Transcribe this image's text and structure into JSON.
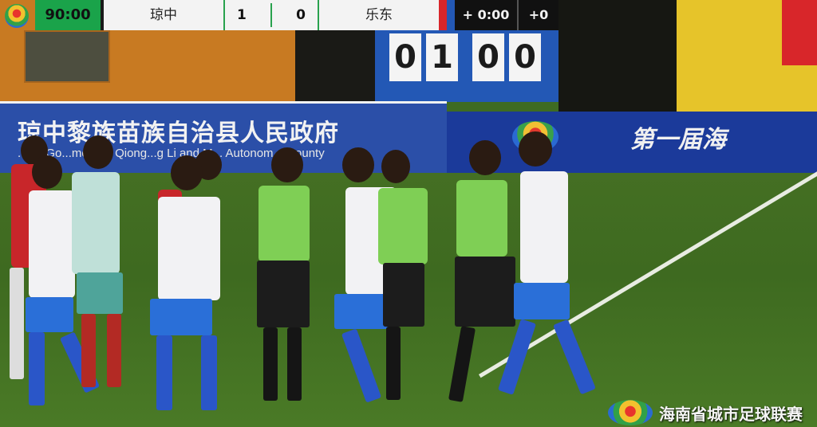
{
  "scoreboard": {
    "clock": "90:00",
    "home_team": "琼中",
    "home_score": "1",
    "away_score": "0",
    "away_team": "乐东",
    "added_time": "+ 0:00",
    "added_goals": "+0"
  },
  "stadium_board": {
    "digits": [
      "0",
      "1",
      "0",
      "0"
    ]
  },
  "banners": {
    "left_title": "琼中黎族苗族自治县人民政府",
    "left_subtitle": "...e's Go...ment of Qiong...g Li and M... Autonom... County",
    "right_title": "第一届海"
  },
  "league": {
    "name": "海南省城市足球联赛"
  },
  "colors": {
    "clock_green": "#1aa34a",
    "home_kit": "#f4f4f6",
    "home_shorts": "#2a6fd8",
    "referee_shirt": "#7fcf55",
    "away_kit": "#c8262a",
    "pitch": "#3f6c22"
  }
}
